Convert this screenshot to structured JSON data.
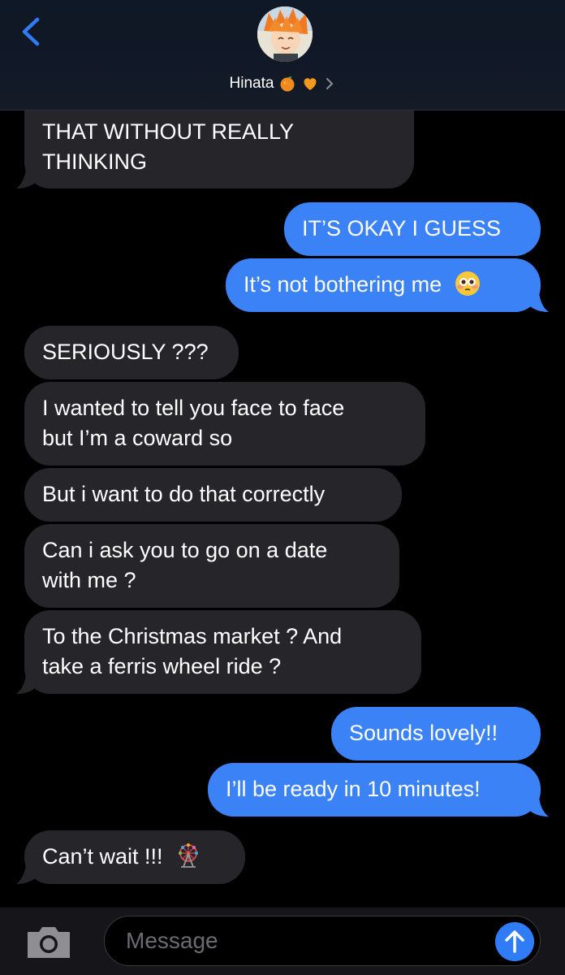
{
  "header": {
    "contact_name": "Hinata",
    "back_icon": "chevron-left-icon",
    "accent_color": "#2f7cf6"
  },
  "messages": [
    {
      "id": "m1",
      "side": "in",
      "lines": [
        "THAT WITHOUT REALLY",
        "THINKING"
      ]
    },
    {
      "id": "m2",
      "side": "out",
      "lines": [
        "IT’S OKAY I GUESS"
      ]
    },
    {
      "id": "m3",
      "side": "out",
      "lines": [
        "It’s not bothering me"
      ],
      "emoji": "flushed-face-icon"
    },
    {
      "id": "m4",
      "side": "in",
      "lines": [
        "SERIOUSLY ???"
      ]
    },
    {
      "id": "m5",
      "side": "in",
      "lines": [
        "I wanted to tell you face to face",
        "but I’m a coward so"
      ]
    },
    {
      "id": "m6",
      "side": "in",
      "lines": [
        "But i want to do that correctly"
      ]
    },
    {
      "id": "m7",
      "side": "in",
      "lines": [
        "Can i ask you to go on a date",
        "with me ?"
      ]
    },
    {
      "id": "m8",
      "side": "in",
      "lines": [
        "To the Christmas market ? And",
        "take a ferris wheel ride ?"
      ]
    },
    {
      "id": "m9",
      "side": "out",
      "lines": [
        "Sounds lovely!!"
      ]
    },
    {
      "id": "m10",
      "side": "out",
      "lines": [
        "I’ll be ready in 10 minutes!"
      ]
    },
    {
      "id": "m11",
      "side": "in",
      "lines": [
        "Can’t wait !!!"
      ],
      "emoji": "ferris-wheel-icon"
    }
  ],
  "composer": {
    "placeholder": "Message",
    "camera_icon": "camera-icon",
    "send_icon": "arrow-up-icon"
  }
}
